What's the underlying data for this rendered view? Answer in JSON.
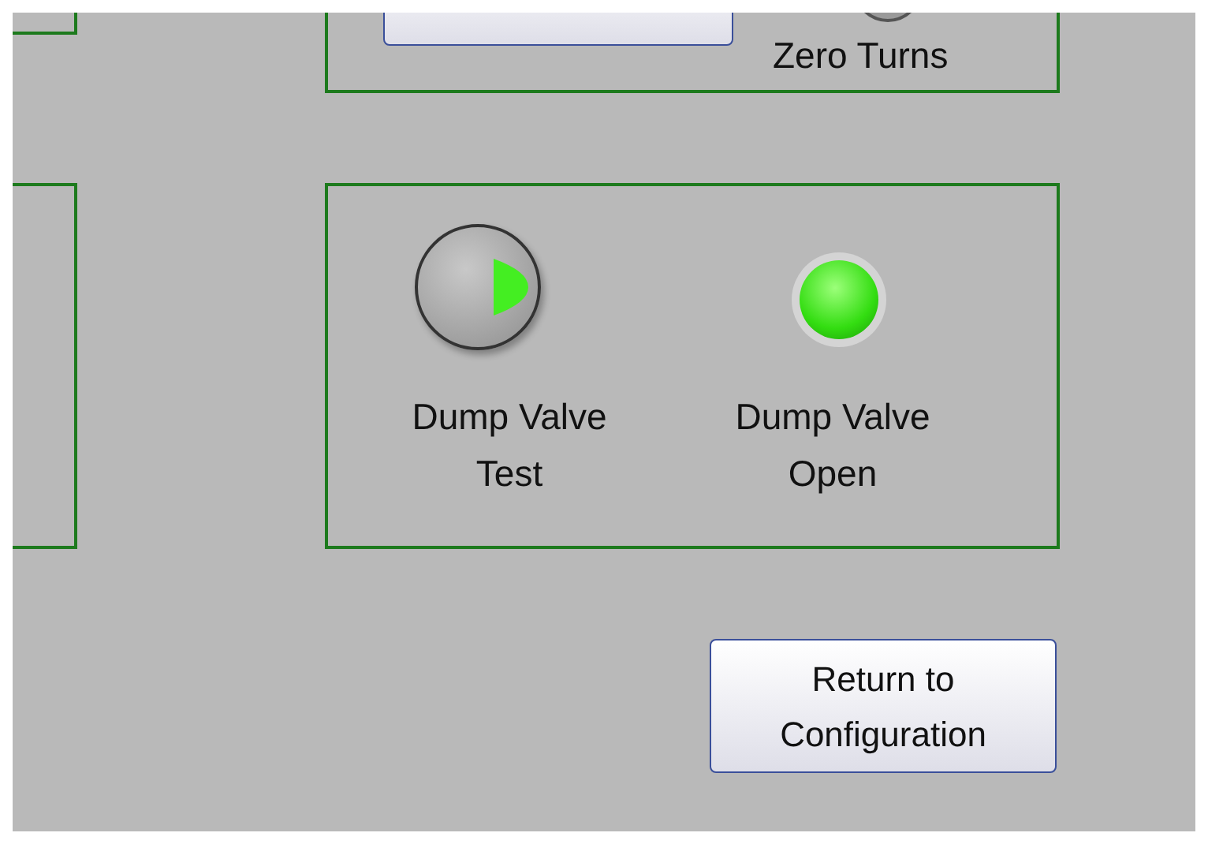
{
  "zero_panel": {
    "knob_label": "Zero Turns"
  },
  "dump_panel": {
    "test_button": {
      "label": "Dump Valve Test",
      "on": true
    },
    "open_indicator": {
      "label": "Dump Valve Open",
      "on": true
    }
  },
  "return_button": {
    "label": "Return to Configuration"
  }
}
